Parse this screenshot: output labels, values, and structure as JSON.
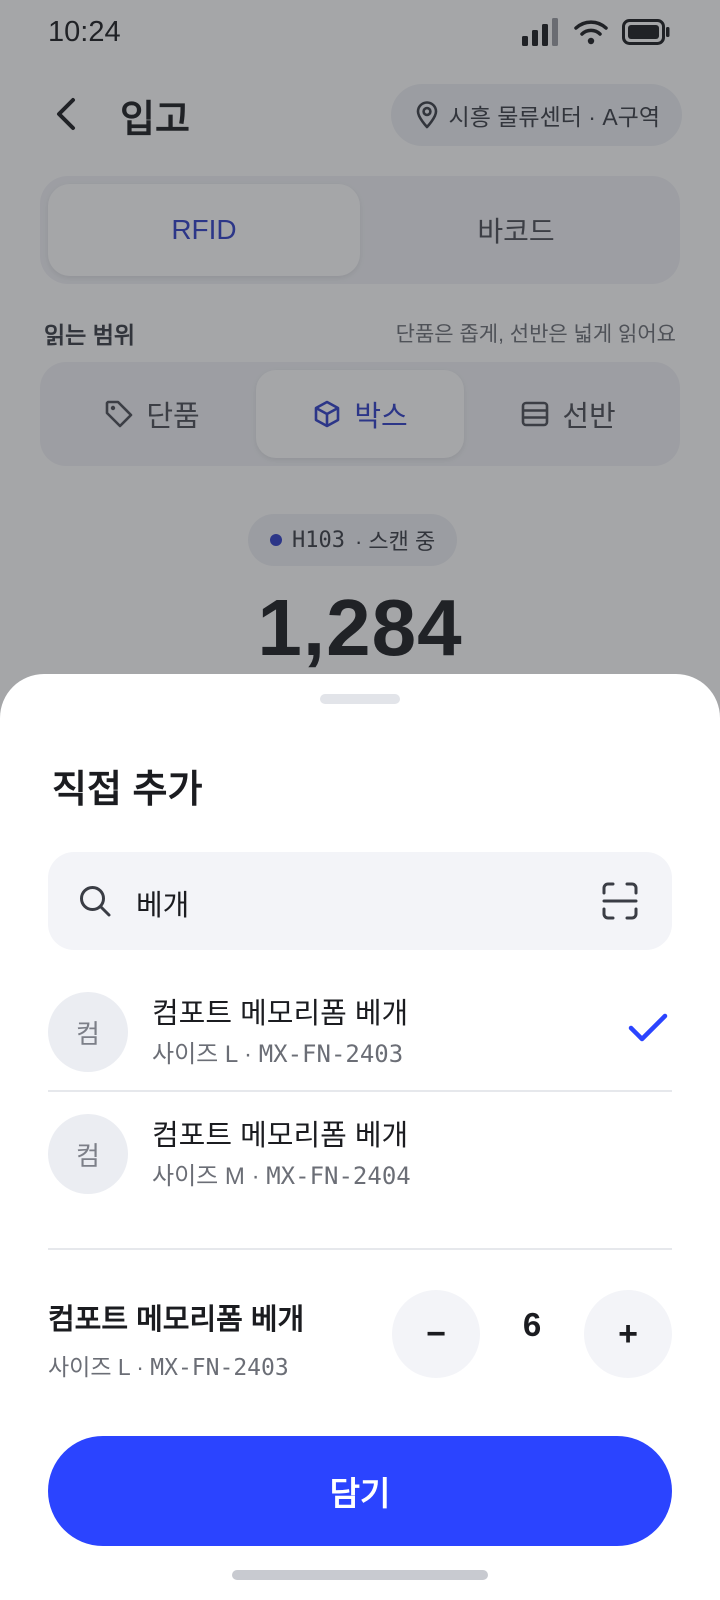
{
  "status": {
    "time": "10:24"
  },
  "header": {
    "title": "입고",
    "location": "시흥 물류센터 · A구역"
  },
  "mode_tabs": [
    {
      "label": "RFID",
      "active": true
    },
    {
      "label": "바코드",
      "active": false
    }
  ],
  "range": {
    "label": "읽는 범위",
    "hint": "단품은 좁게, 선반은 넓게 읽어요",
    "options": [
      {
        "label": "단품",
        "icon": "tag-icon",
        "active": false
      },
      {
        "label": "박스",
        "icon": "box-icon",
        "active": true
      },
      {
        "label": "선반",
        "icon": "shelf-icon",
        "active": false
      }
    ]
  },
  "scan": {
    "reader": "H103",
    "status": "· 스캔 중",
    "count": "1,284"
  },
  "sheet": {
    "title": "직접 추가",
    "search": {
      "value": "베개",
      "icon": "search-icon",
      "scan_icon": "barcode-scan-icon"
    },
    "results": [
      {
        "avatar": "컴",
        "name": "컴포트 메모리폼 베개",
        "size": "사이즈 L · ",
        "sku": "MX-FN-2403",
        "selected": true
      },
      {
        "avatar": "컴",
        "name": "컴포트 메모리폼 베개",
        "size": "사이즈 M · ",
        "sku": "MX-FN-2404",
        "selected": false
      }
    ],
    "selected": {
      "name": "컴포트 메모리폼 베개",
      "size": "사이즈 L · ",
      "sku": "MX-FN-2403"
    },
    "stepper": {
      "minus": "−",
      "plus": "+",
      "quantity": "6"
    },
    "cta": "담기"
  },
  "colors": {
    "accent": "#2b44ff",
    "active_text": "#2f3ec8"
  }
}
